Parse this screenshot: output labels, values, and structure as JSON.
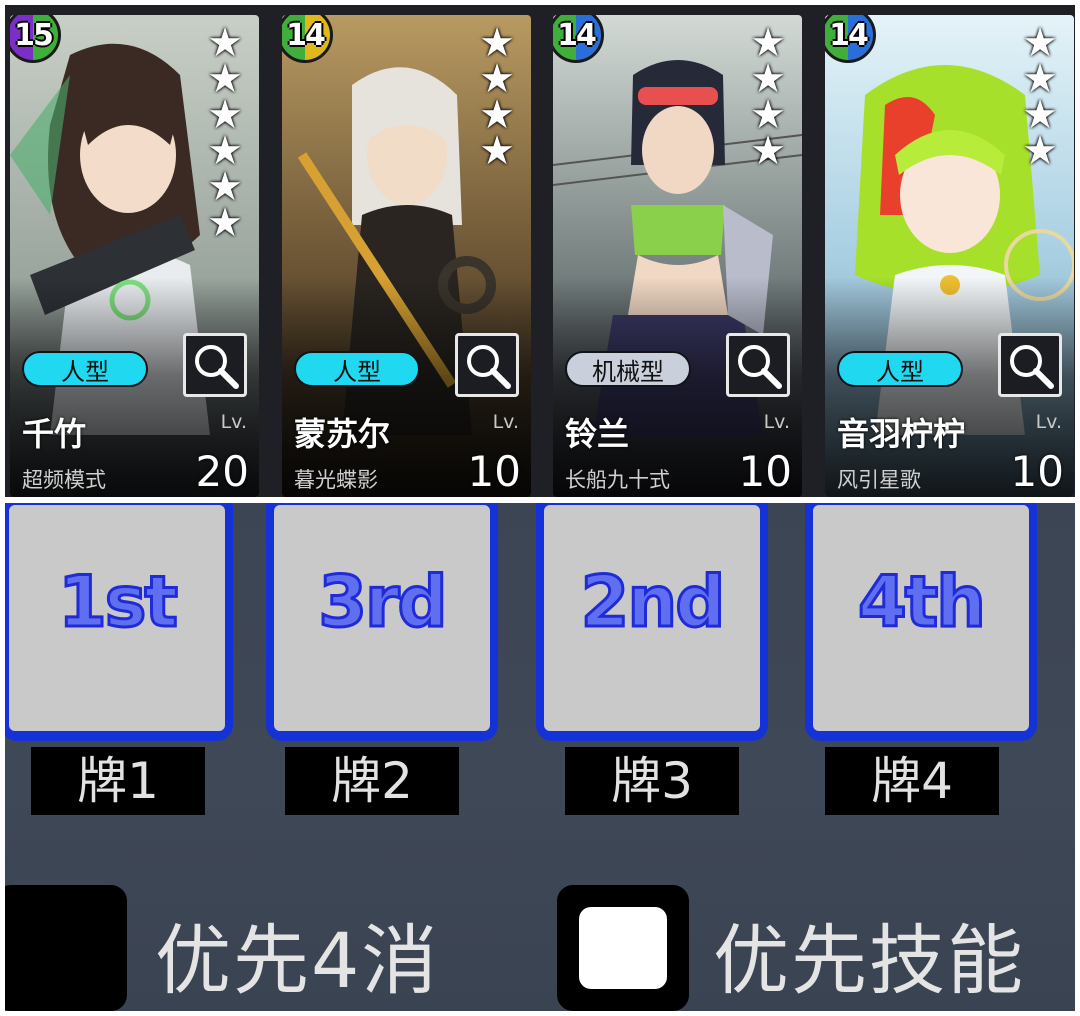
{
  "cards": [
    {
      "level": "15",
      "badge_colors": [
        "#7b2fc7",
        "#3fae3a"
      ],
      "stars": 6,
      "type": "人型",
      "type_color": "#20d8f0",
      "name": "千竹",
      "sub": "超频模式",
      "lv_label": "Lv.",
      "lv": "20",
      "art_colors": [
        "#c8cfc6",
        "#7f8b86",
        "#3a3f45"
      ],
      "icon": "magnifier-icon"
    },
    {
      "level": "14",
      "badge_colors": [
        "#3fae3a",
        "#e0b81c"
      ],
      "stars": 4,
      "type": "人型",
      "type_color": "#20d8f0",
      "name": "蒙苏尔",
      "sub": "暮光蝶影",
      "lv_label": "Lv.",
      "lv": "10",
      "art_colors": [
        "#b89a62",
        "#6e5736",
        "#2c241b"
      ],
      "icon": "magnifier-icon"
    },
    {
      "level": "14",
      "badge_colors": [
        "#3fae3a",
        "#2a6fd8"
      ],
      "stars": 4,
      "type": "机械型",
      "type_color": "#c9d0dc",
      "name": "铃兰",
      "sub": "长船九十式",
      "lv_label": "Lv.",
      "lv": "10",
      "art_colors": [
        "#c9d2cf",
        "#6f7a78",
        "#2a2c38"
      ],
      "icon": "magnifier-icon"
    },
    {
      "level": "14",
      "badge_colors": [
        "#3fae3a",
        "#2a6fd8"
      ],
      "stars": 4,
      "type": "人型",
      "type_color": "#20d8f0",
      "name": "音羽柠柠",
      "sub": "风引星歌",
      "lv_label": "Lv.",
      "lv": "10",
      "art_colors": [
        "#d9eef6",
        "#9cc6de",
        "#6ea0b8"
      ],
      "icon": "magnifier-icon"
    }
  ],
  "order_slots": [
    {
      "rank": "1st",
      "card": "牌1"
    },
    {
      "rank": "3rd",
      "card": "牌2"
    },
    {
      "rank": "2nd",
      "card": "牌3"
    },
    {
      "rank": "4th",
      "card": "牌4"
    }
  ],
  "options": [
    {
      "label": "优先4消",
      "checked": false
    },
    {
      "label": "优先技能",
      "checked": true
    }
  ],
  "colors": {
    "slot_border": "#1432d8",
    "slot_fill": "#c9c9c9",
    "rank_text": "#5f6ff0",
    "panel_bg": "#3f4857"
  }
}
